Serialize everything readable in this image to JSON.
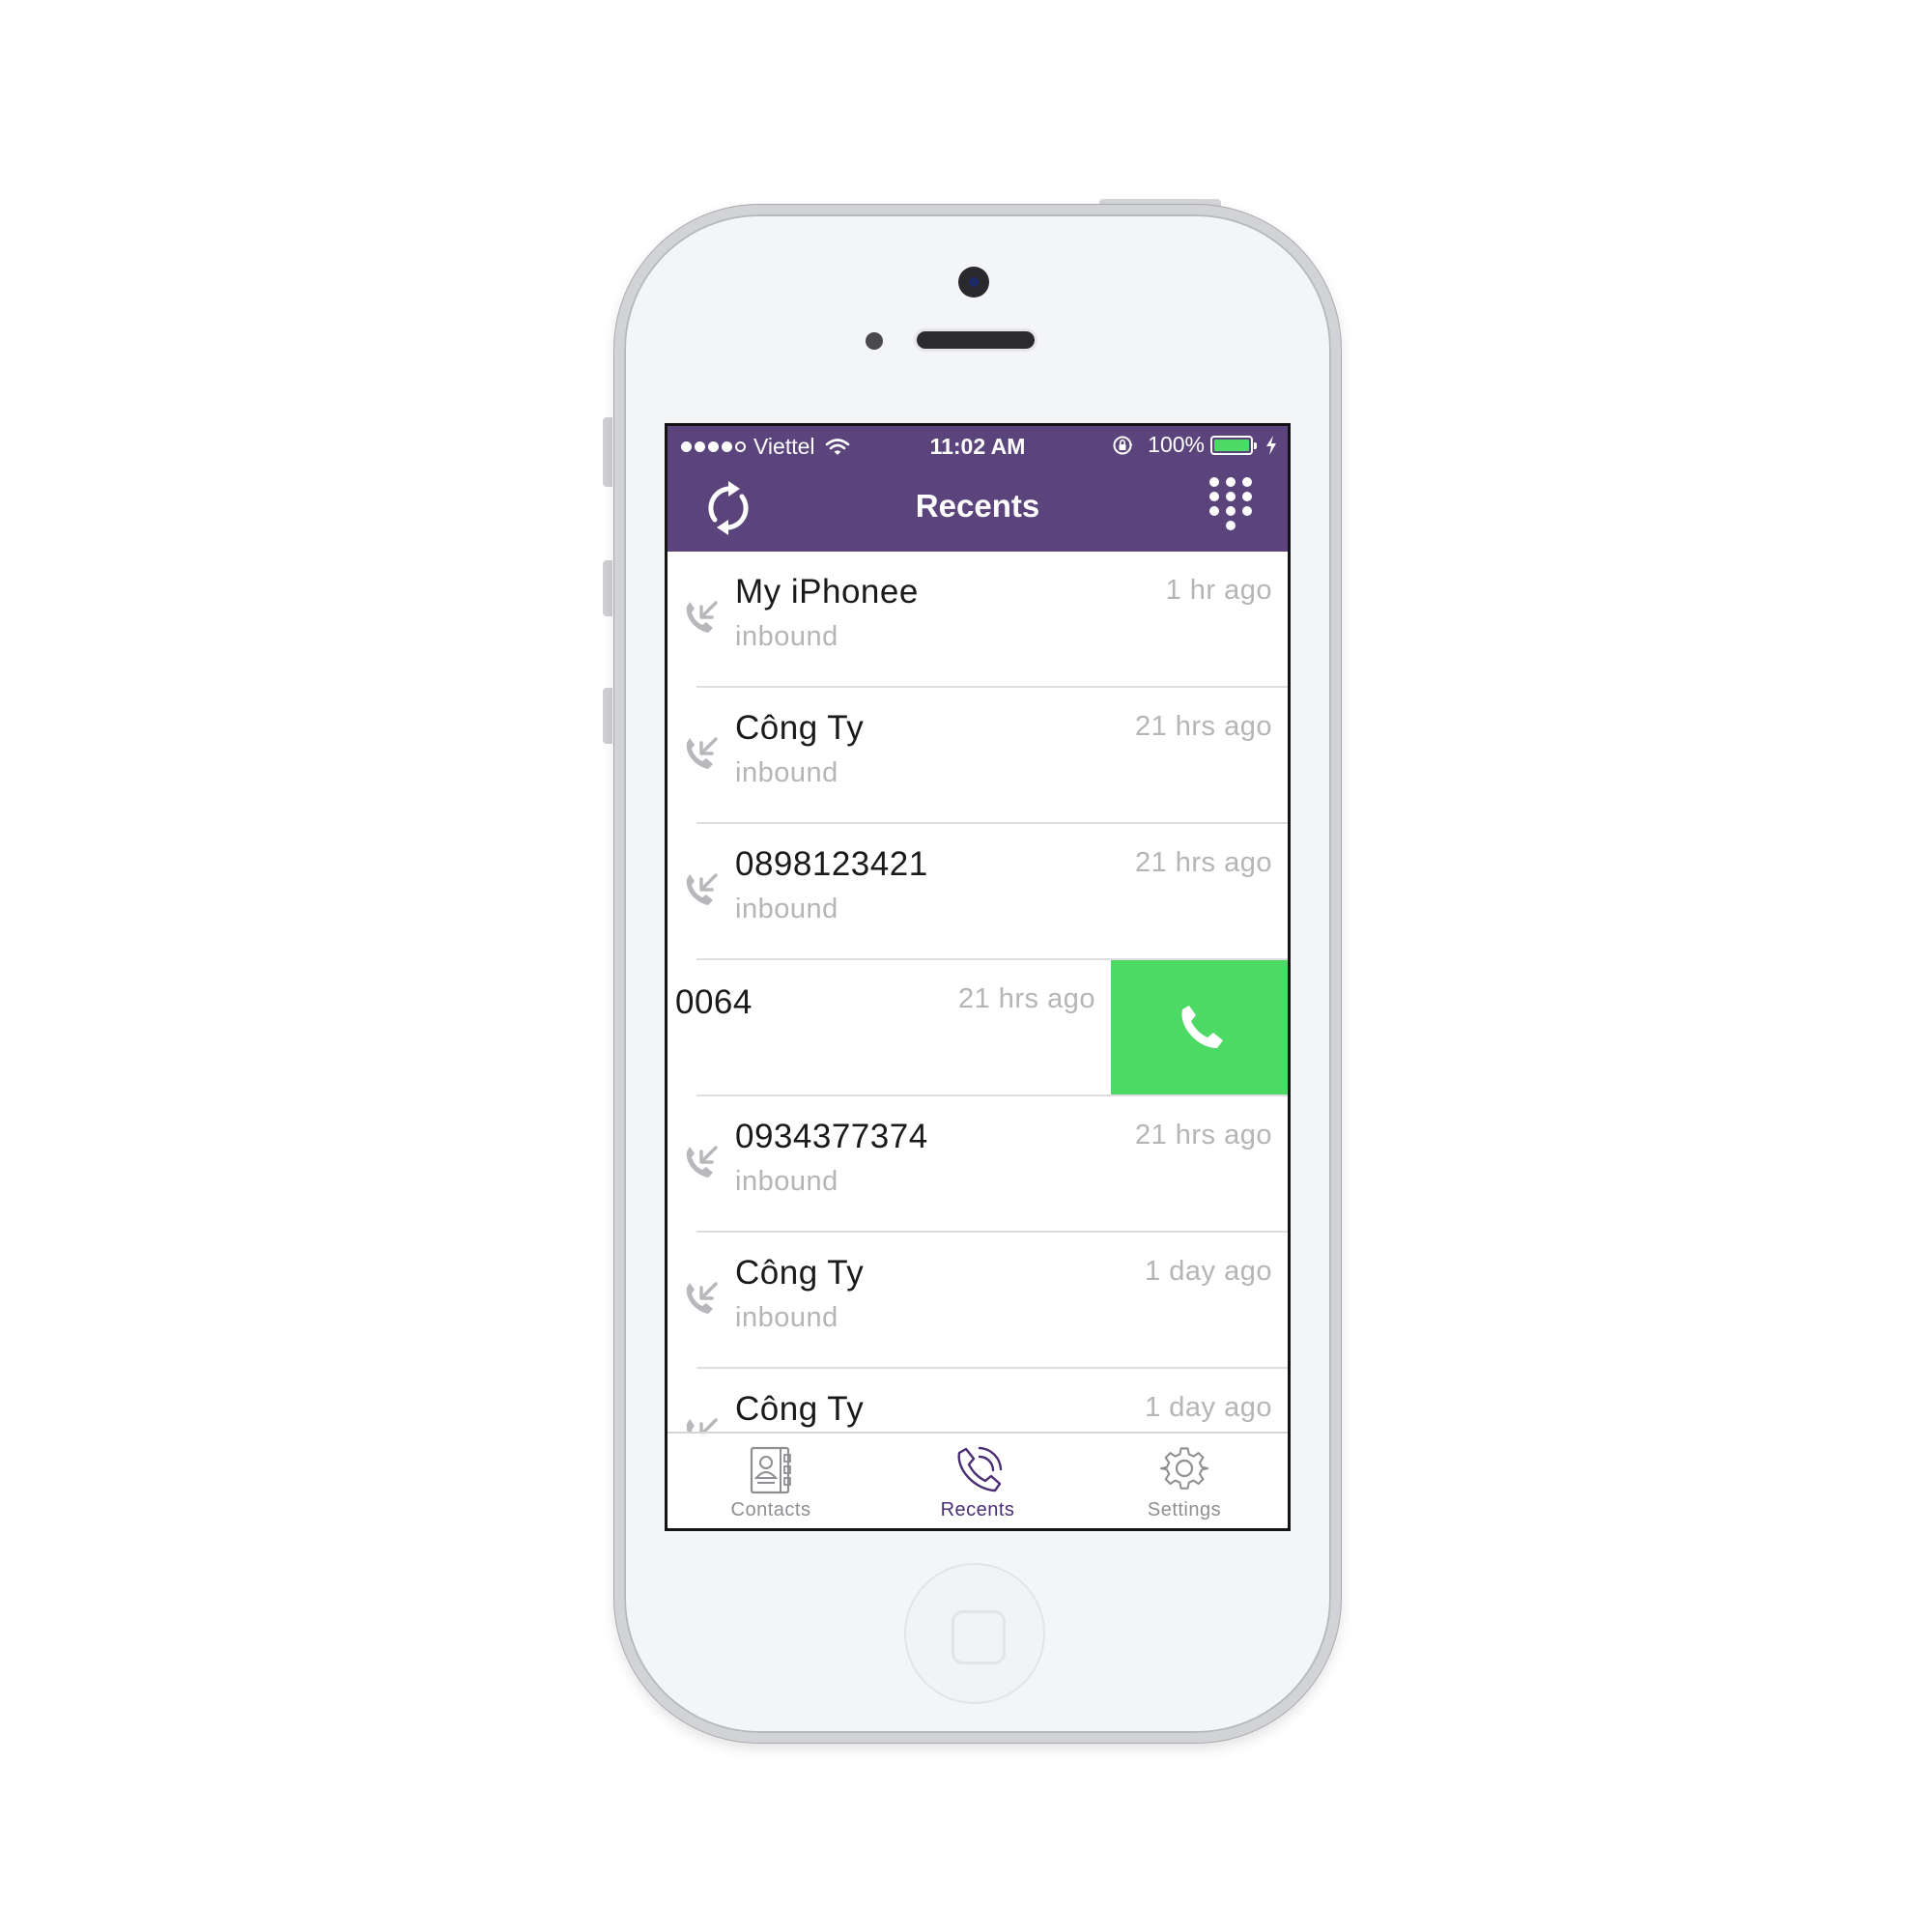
{
  "status_bar": {
    "carrier": "Viettel",
    "signal_bars": 4,
    "signal_max": 5,
    "time": "11:02 AM",
    "battery_percent": "100%",
    "icons": [
      "wifi-icon",
      "orientation-lock-icon",
      "battery-icon",
      "charging-bolt-icon"
    ]
  },
  "nav": {
    "title": "Recents",
    "left_button_icon": "refresh-icon",
    "right_button_icon": "dialpad-icon"
  },
  "calls": [
    {
      "name": "My iPhonee",
      "direction": "inbound",
      "when": "1 hr ago"
    },
    {
      "name": "Công Ty",
      "direction": "inbound",
      "when": "21 hrs ago"
    },
    {
      "name": "0898123421",
      "direction": "inbound",
      "when": "21 hrs ago"
    },
    {
      "name": "0064",
      "direction": "",
      "when": "21 hrs ago",
      "swipe_action_icon": "phone-icon"
    },
    {
      "name": "0934377374",
      "direction": "inbound",
      "when": "21 hrs ago"
    },
    {
      "name": "Công Ty",
      "direction": "inbound",
      "when": "1 day ago"
    },
    {
      "name": "Công Ty",
      "direction": "",
      "when": "1 day ago"
    }
  ],
  "tabs": [
    {
      "label": "Contacts",
      "icon": "contacts-book-icon",
      "active": false
    },
    {
      "label": "Recents",
      "icon": "recents-phone-icon",
      "active": true
    },
    {
      "label": "Settings",
      "icon": "gear-icon",
      "active": false
    }
  ],
  "colors": {
    "brand": "#5a447b",
    "call_action": "#4cd964",
    "tab_active": "#4a2e74",
    "muted": "#b5b5b8"
  }
}
